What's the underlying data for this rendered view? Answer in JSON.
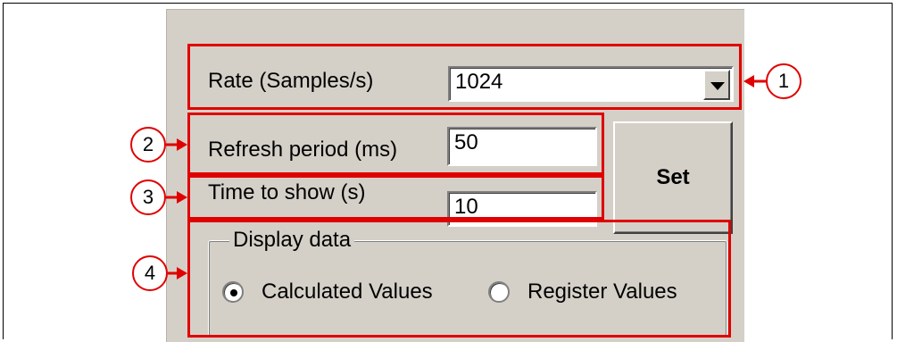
{
  "settings": {
    "rate": {
      "label": "Rate (Samples/s)",
      "value": "1024"
    },
    "refresh": {
      "label": "Refresh period (ms)",
      "value": "50"
    },
    "time": {
      "label": "Time to show (s)",
      "value": "10"
    },
    "set_label": "Set"
  },
  "display_data": {
    "legend": "Display data",
    "options": [
      {
        "label": "Calculated Values",
        "selected": true
      },
      {
        "label": "Register Values",
        "selected": false
      }
    ]
  },
  "callouts": [
    "1",
    "2",
    "3",
    "4"
  ],
  "colors": {
    "highlight": "#e00000",
    "panel": "#d4d0c8"
  }
}
